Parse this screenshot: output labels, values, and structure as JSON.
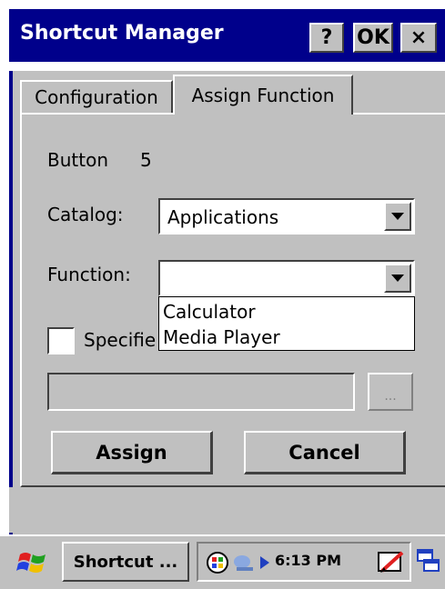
{
  "window": {
    "title": "Shortcut Manager",
    "help_label": "?",
    "ok_label": "OK",
    "close_label": "×"
  },
  "tabs": [
    {
      "label": "Configuration",
      "active": false
    },
    {
      "label": "Assign Function",
      "active": true
    }
  ],
  "form": {
    "button_label": "Button",
    "button_number": "5",
    "catalog_label": "Catalog:",
    "catalog_value": "Applications",
    "function_label": "Function:",
    "function_value": "",
    "function_options": [
      "Calculator",
      "Media Player"
    ],
    "specific_label": "Specifie",
    "specific_checked": false,
    "path_value": "",
    "browse_label": "...",
    "assign_label": "Assign",
    "cancel_label": "Cancel"
  },
  "taskbar": {
    "task_label": "Shortcut ...",
    "clock": "6:13 PM",
    "icons": [
      "windows-flag-icon",
      "network-icon",
      "connection-icon",
      "tray-arrow-icon",
      "pen-icon",
      "switch-windows-icon"
    ]
  },
  "colors": {
    "titlebar": "#00008b",
    "face": "#c0c0c0"
  }
}
